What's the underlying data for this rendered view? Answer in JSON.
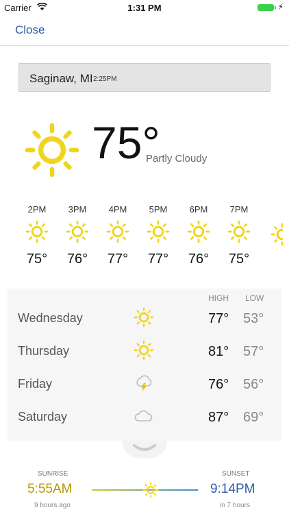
{
  "status": {
    "carrier": "Carrier",
    "time": "1:31 PM"
  },
  "nav": {
    "close_label": "Close"
  },
  "location": {
    "city": "Saginaw, MI",
    "time": "2:25PM"
  },
  "current": {
    "temp": "75°",
    "condition": "Partly Cloudy",
    "icon": "sun-icon"
  },
  "hourly": [
    {
      "time": "2PM",
      "temp": "75°",
      "icon": "sun-icon"
    },
    {
      "time": "3PM",
      "temp": "76°",
      "icon": "sun-icon"
    },
    {
      "time": "4PM",
      "temp": "77°",
      "icon": "sun-icon"
    },
    {
      "time": "5PM",
      "temp": "77°",
      "icon": "sun-icon"
    },
    {
      "time": "6PM",
      "temp": "76°",
      "icon": "sun-icon"
    },
    {
      "time": "7PM",
      "temp": "75°",
      "icon": "sun-icon"
    }
  ],
  "daily": {
    "high_label": "HIGH",
    "low_label": "LOW",
    "days": [
      {
        "day": "Wednesday",
        "high": "77°",
        "low": "53°",
        "icon": "sun-icon"
      },
      {
        "day": "Thursday",
        "high": "81°",
        "low": "57°",
        "icon": "sun-icon"
      },
      {
        "day": "Friday",
        "high": "76°",
        "low": "56°",
        "icon": "thunderstorm-icon"
      },
      {
        "day": "Saturday",
        "high": "87°",
        "low": "69°",
        "icon": "cloud-icon"
      }
    ]
  },
  "sun": {
    "sunrise_label": "SUNRISE",
    "sunrise_time": "5:55AM",
    "sunrise_sub": "9 hours ago",
    "sunset_label": "SUNSET",
    "sunset_time": "9:14PM",
    "sunset_sub": "in 7 hours"
  },
  "colors": {
    "accent": "#2b5ea8",
    "sun": "#f0d520",
    "sunrise": "#b59a00"
  }
}
